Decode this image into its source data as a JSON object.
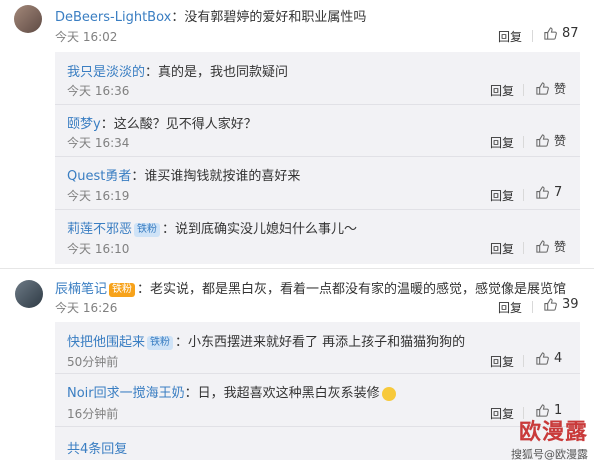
{
  "comments": [
    {
      "user": "DeBeers-LightBox",
      "text": "：没有郭碧婷的爱好和职业属性吗",
      "time": "今天 16:02",
      "reply": "回复",
      "likes": "87"
    },
    {
      "user": "辰楠笔记",
      "text": "：老实说，都是黑白灰，看着一点都没有家的温暖的感觉，感觉像是展览馆",
      "time": "今天 16:26",
      "reply": "回复",
      "likes": "39"
    }
  ],
  "replies_a": [
    {
      "user": "我只是淡淡的",
      "text": "：真的是，我也同款疑问",
      "time": "今天 16:36",
      "reply": "回复",
      "likes": "赞"
    },
    {
      "user": "颐梦y",
      "text": "：这么酸？见不得人家好？",
      "time": "今天 16:34",
      "reply": "回复",
      "likes": "赞"
    },
    {
      "user": "Quest勇者",
      "text": "：谁买谁掏钱就按谁的喜好来",
      "time": "今天 16:19",
      "reply": "回复",
      "likes": "7"
    },
    {
      "user": "莉莲不邪恶",
      "badge": "铁粉",
      "text": "：说到底确实没儿媳妇什么事儿～",
      "time": "今天 16:10",
      "reply": "回复",
      "likes": "赞"
    }
  ],
  "replies_b": [
    {
      "user": "快把他围起来",
      "badge": "铁粉",
      "text": "：小东西摆进来就好看了 再添上孩子和猫猫狗狗的",
      "time": "50分钟前",
      "reply": "回复",
      "likes": "4"
    },
    {
      "user": "Noir回求一搅海王奶",
      "text": "：日，我超喜欢这种黑白灰系装修",
      "time": "16分钟前",
      "reply": "回复",
      "likes": "1"
    }
  ],
  "more_replies": "共4条回复",
  "badges": {
    "gold": "铁粉"
  },
  "watermark": {
    "big": "欧漫露",
    "small": "搜狐号@欧漫露"
  },
  "colors": {
    "username": "#eb7350",
    "link_blue": "#3a7ec2",
    "reply_bg": "#f2f2f5"
  }
}
